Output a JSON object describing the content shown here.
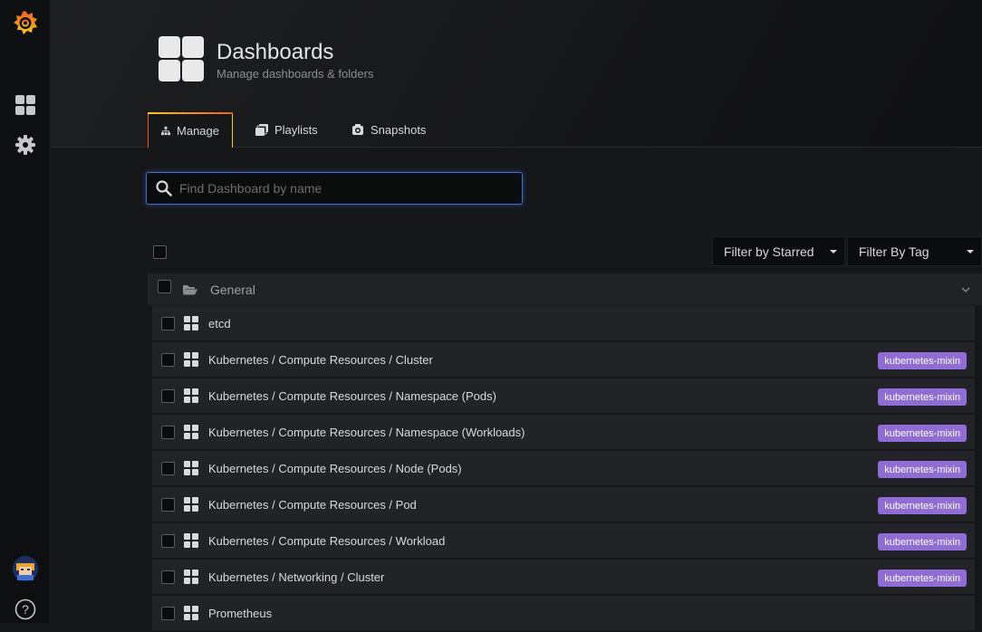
{
  "header": {
    "title": "Dashboards",
    "subtitle": "Manage dashboards & folders"
  },
  "tabs": [
    {
      "label": "Manage",
      "icon": "sitemap-icon",
      "active": true
    },
    {
      "label": "Playlists",
      "icon": "playlist-icon",
      "active": false
    },
    {
      "label": "Snapshots",
      "icon": "snapshot-icon",
      "active": false
    }
  ],
  "search": {
    "placeholder": "Find Dashboard by name",
    "value": ""
  },
  "filters": {
    "starred": "Filter by Starred",
    "tag": "Filter By Tag"
  },
  "folder": {
    "name": "General"
  },
  "dashboards": [
    {
      "title": "etcd",
      "tag": ""
    },
    {
      "title": "Kubernetes / Compute Resources / Cluster",
      "tag": "kubernetes-mixin"
    },
    {
      "title": "Kubernetes / Compute Resources / Namespace (Pods)",
      "tag": "kubernetes-mixin"
    },
    {
      "title": "Kubernetes / Compute Resources / Namespace (Workloads)",
      "tag": "kubernetes-mixin"
    },
    {
      "title": "Kubernetes / Compute Resources / Node (Pods)",
      "tag": "kubernetes-mixin"
    },
    {
      "title": "Kubernetes / Compute Resources / Pod",
      "tag": "kubernetes-mixin"
    },
    {
      "title": "Kubernetes / Compute Resources / Workload",
      "tag": "kubernetes-mixin"
    },
    {
      "title": "Kubernetes / Networking / Cluster",
      "tag": "kubernetes-mixin"
    },
    {
      "title": "Prometheus",
      "tag": ""
    }
  ],
  "colors": {
    "accent": "#f05a28",
    "tag": "#8f6dd6",
    "focus": "#3d71d9"
  }
}
